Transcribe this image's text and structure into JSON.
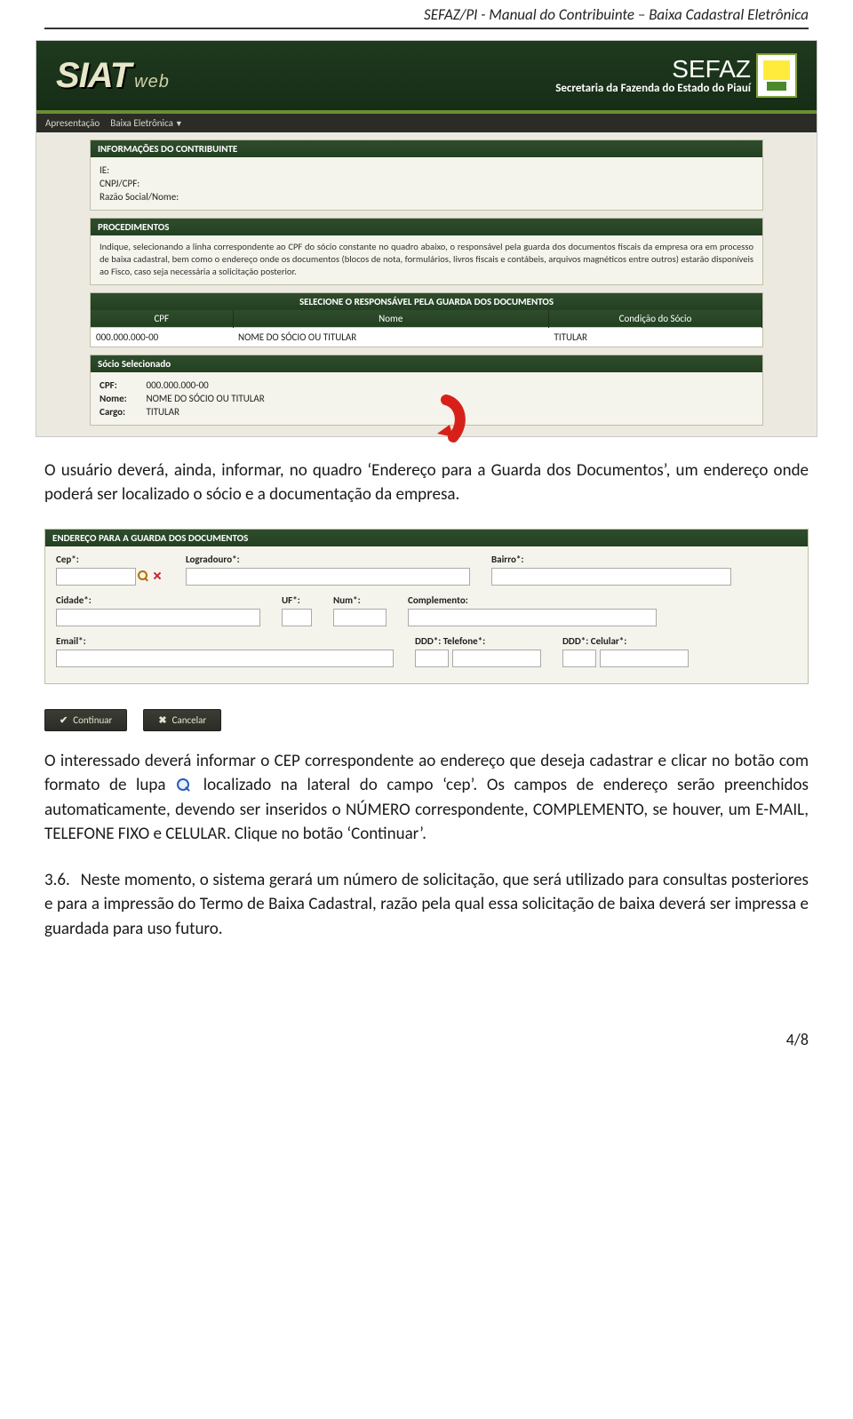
{
  "doc_header": "SEFAZ/PI - Manual do Contribuinte – Baixa Cadastral Eletrônica",
  "siat": {
    "logo_main": "SIAT",
    "logo_sub": "web",
    "org_main": "SEFAZ",
    "org_sub": "Secretaria da Fazenda do Estado do Piauí"
  },
  "menu": {
    "item1": "Apresentação",
    "item2": "Baixa Eletrônica"
  },
  "panels": {
    "info_header": "INFORMAÇÕES DO CONTRIBUINTE",
    "info": {
      "ie": "IE:",
      "cnpj": "CNPJ/CPF:",
      "razao": "Razão Social/Nome:"
    },
    "proc_header": "PROCEDIMENTOS",
    "proc_text": "Indique, selecionando a linha correspondente ao CPF do sócio constante no quadro abaixo, o responsável pela guarda dos documentos fiscais da empresa ora em processo de baixa cadastral, bem como o endereço onde os documentos (blocos de nota, formulários, livros fiscais e contábeis, arquivos magnéticos entre outros) estarão disponíveis ao Fisco, caso seja necessária a solicitação posterior.",
    "table_header": "SELECIONE O RESPONSÁVEL PELA GUARDA DOS DOCUMENTOS",
    "cols": {
      "cpf": "CPF",
      "nome": "Nome",
      "cond": "Condição do Sócio"
    },
    "row": {
      "cpf": "000.000.000-00",
      "nome": "NOME DO SÓCIO OU TITULAR",
      "cond": "TITULAR"
    },
    "sel_header": "Sócio Selecionado",
    "sel": {
      "cpf_l": "CPF:",
      "cpf_v": "000.000.000-00",
      "nome_l": "Nome:",
      "nome_v": "NOME DO SÓCIO OU TITULAR",
      "cargo_l": "Cargo:",
      "cargo_v": "TITULAR"
    }
  },
  "p1": "O usuário deverá, ainda, informar, no quadro ‘Endereço para a Guarda dos Documentos’, um endereço onde poderá ser localizado o sócio e a documentação da empresa.",
  "form": {
    "header": "ENDEREÇO PARA A GUARDA DOS DOCUMENTOS",
    "cep": "Cep*:",
    "logradouro": "Logradouro*:",
    "bairro": "Bairro*:",
    "cidade": "Cidade*:",
    "uf": "UF*:",
    "num": "Num*:",
    "compl": "Complemento:",
    "email": "Email*:",
    "ddd_tel": "DDD*: Telefone*:",
    "ddd_cel": "DDD*: Celular*:"
  },
  "buttons": {
    "continuar": "Continuar",
    "cancelar": "Cancelar"
  },
  "p2a": "O interessado deverá informar o CEP correspondente ao endereço que deseja cadastrar e clicar no botão com formato de lupa ",
  "p2b": " localizado na lateral do campo ‘cep’. Os campos de endereço serão preenchidos automaticamente, devendo ser inseridos o NÚMERO correspondente, COMPLEMENTO, se houver, um E-MAIL, TELEFONE FIXO e CELULAR. Clique no botão ‘Continuar’.",
  "p3_num": "3.6.",
  "p3": "Neste momento, o sistema gerará um número de solicitação, que será utilizado para consultas posteriores e para a impressão do Termo de Baixa Cadastral, razão pela qual essa solicitação de baixa deverá ser impressa e guardada para uso futuro.",
  "page_num": "4/8"
}
